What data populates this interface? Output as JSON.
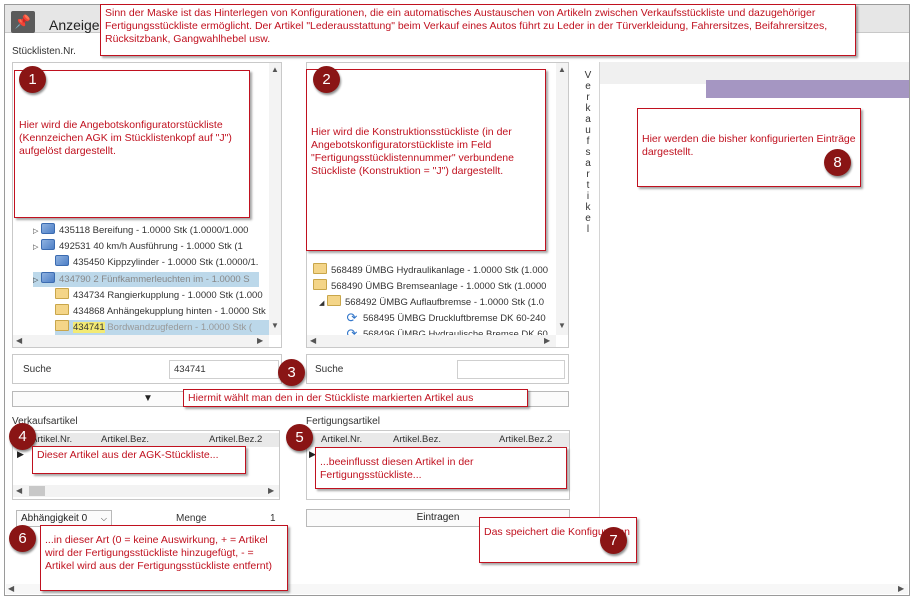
{
  "window": {
    "title": "Anzeige"
  },
  "labels": {
    "stuecklisten_nr": "Stücklisten.Nr.",
    "verkaufsartikel": "Verkaufsartikel",
    "fertigungsartikel": "Fertigungsartikel",
    "suche": "Suche",
    "suche_value": "434741",
    "menge": "Menge",
    "menge_value": "1",
    "abhaengigkeit": "Abhängigkeit",
    "abhaengigkeit_value": "0",
    "eintragen": "Eintragen",
    "vertical_tab": "Verkaufsartikel"
  },
  "grid_columns": {
    "col1": "Artikel.Nr.",
    "col2": "Artikel.Bez.",
    "col3": "Artikel.Bez.2"
  },
  "left_tree": [
    {
      "text": "435118 Bereifung  - 1.0000 Stk (1.0000/1.000",
      "icon": "cube"
    },
    {
      "text": "492531 40 km/h Ausführung  - 1.0000 Stk (1",
      "icon": "cube"
    },
    {
      "text": "435450 Kippzylinder  - 1.0000 Stk (1.0000/1.",
      "icon": "cube"
    },
    {
      "text": "434790 2 Fünfkammerleuchten im - 1.0000 S",
      "icon": "cube"
    },
    {
      "text": "434734 Rangierkupplung - 1.0000 Stk (1.000",
      "icon": "folder"
    },
    {
      "text": "434868 Anhängekupplung hinten - 1.0000 Stk",
      "icon": "folder"
    },
    {
      "num": "434741",
      "text": " Bordwandzugfedern - 1.0000 Stk (",
      "icon": "folder"
    }
  ],
  "right_tree": [
    {
      "text": "568489 ÜMBG Hydraulikanlage - 1.0000 Stk (1.000",
      "icon": "folder"
    },
    {
      "text": "568490 ÜMBG Bremseanlage - 1.0000 Stk (1.0000",
      "icon": "folder"
    },
    {
      "text": "568492 ÜMBG Auflaufbremse - 1.0000 Stk (1.0",
      "icon": "folder"
    },
    {
      "text": "568495 ÜMBG Druckluftbremse DK 60-240",
      "icon": "cycle"
    },
    {
      "text": "568496 ÜMBG Hydraulische Bremse DK 60",
      "icon": "cycle"
    }
  ],
  "annotations": {
    "top": "Sinn der Maske ist das Hinterlegen von Konfigurationen, die ein automatisches Austauschen von Artikeln zwischen Verkaufsstückliste und dazugehöriger Fertigungsstückliste ermöglicht. Der Artikel \"Lederausstattung\" beim Verkauf eines Autos führt zu Leder in der Türverkleidung, Fahrersitzes, Beifahrersitzes, Rücksitzbank, Gangwahlhebel usw.",
    "n1": "Hier wird die Angebotskonfiguratorstückliste (Kennzeichen AGK im Stücklistenkopf auf \"J\") aufgelöst dargestellt.",
    "n2": "Hier wird die Konstruktionsstückliste (in der Angebotskonfiguratorstückliste im Feld \"Fertigungsstücklistennummer\" verbundene Stückliste (Konstruktion = \"J\") dargestellt.",
    "n3": "Hiermit wählt man den in der Stückliste markierten Artikel aus",
    "n4": "Dieser Artikel aus der AGK-Stückliste...",
    "n5": "...beeinflusst diesen Artikel in der Fertigungsstückliste...",
    "n6": "...in dieser Art (0 = keine Auswirkung, + = Artikel wird der Fertigungsstückliste hinzugefügt, - = Artikel wird aus der Fertigungsstückliste entfernt)",
    "n7": "Das speichert die Konfiguration",
    "n8": "Hier werden die bisher konfigurierten Einträge dargestellt."
  },
  "badges": {
    "b1": "1",
    "b2": "2",
    "b3": "3",
    "b4": "4",
    "b5": "5",
    "b6": "6",
    "b7": "7",
    "b8": "8"
  },
  "colors": {
    "annotation_red": "#c0111f",
    "badge": "#8a1515",
    "selection": "#bcd8ea",
    "highlight": "#f3ea73",
    "purple_bar": "#a596c2"
  }
}
